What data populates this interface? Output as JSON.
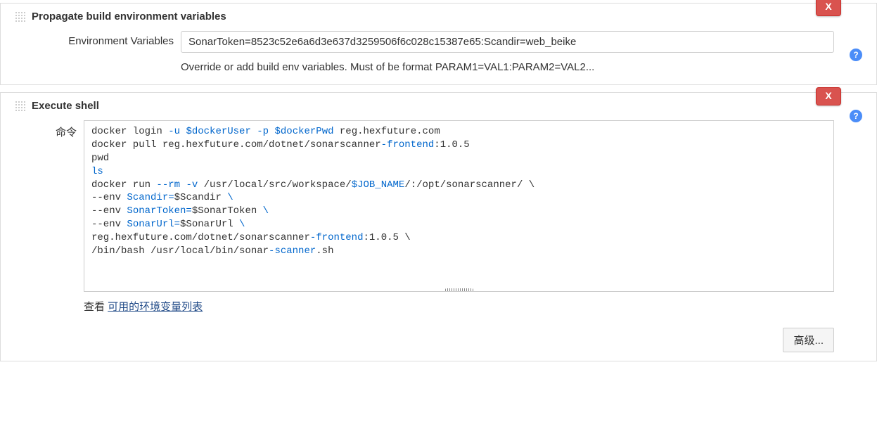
{
  "close_label": "X",
  "propagate": {
    "title": "Propagate build environment variables",
    "env_vars_label": "Environment Variables",
    "env_vars_value": "SonarToken=8523c52e6a6d3e637d3259506f6c028c15387e65:Scandir=web_beike",
    "hint": "Override or add build env variables. Must of be format PARAM1=VAL1:PARAM2=VAL2..."
  },
  "exec": {
    "title": "Execute shell",
    "command_label": "命令",
    "see_label": "查看 ",
    "see_link": "可用的环境变量列表",
    "advanced_label": "高级...",
    "cmd": {
      "l1": [
        "docker login ",
        "-u",
        " ",
        "$dockerUser",
        " ",
        "-p",
        " ",
        "$dockerPwd",
        " reg.hexfuture.com"
      ],
      "l2": [
        "docker pull reg.hexfuture.com/dotnet/sonarscanner",
        "-frontend",
        ":1.0.5"
      ],
      "l3": [
        "pwd"
      ],
      "l4": [
        "ls"
      ],
      "l5": [
        "docker run ",
        "--rm",
        " ",
        "-v",
        " /usr/local/src/workspace/",
        "$JOB_NAME",
        "/:/opt/sonarscanner/ \\"
      ],
      "l6": [
        "--env",
        " Scandir=",
        "$Scandir",
        " \\"
      ],
      "l7": [
        "--env",
        " SonarToken=",
        "$SonarToken",
        " \\"
      ],
      "l8": [
        "--env",
        " SonarUrl=",
        "$SonarUrl",
        " \\"
      ],
      "l9": [
        "reg.hexfuture.com/dotnet/sonarscanner",
        "-frontend",
        ":1.0.5 \\"
      ],
      "l10": [
        "/bin/bash /usr/local/bin/sonar",
        "-scanner",
        ".sh"
      ]
    }
  }
}
